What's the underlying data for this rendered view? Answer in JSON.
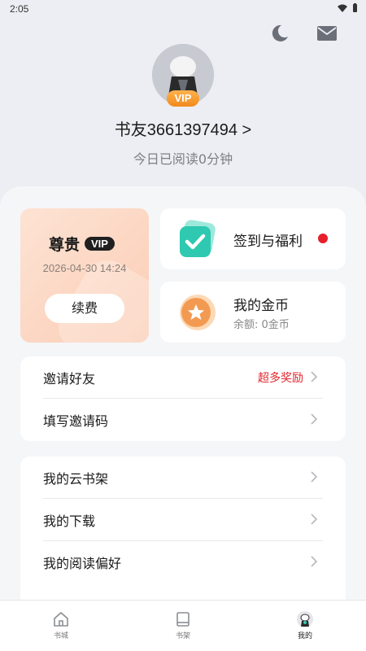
{
  "status_bar": {
    "time": "2:05",
    "icons": [
      "wifi-icon",
      "battery-icon"
    ]
  },
  "header": {
    "icons": [
      "moon-icon",
      "mail-icon"
    ],
    "avatar_badge": "VIP",
    "username": "书友3661397494 >",
    "read_time": "今日已阅读0分钟"
  },
  "vip_card": {
    "title": "尊贵",
    "badge": "VIP",
    "expire_date": "2026-04-30 14:24",
    "renew_label": "续费"
  },
  "checkin_card": {
    "label": "签到与福利",
    "has_notification": true
  },
  "coins_card": {
    "label": "我的金币",
    "balance": "余额: 0金币"
  },
  "invite_list": [
    {
      "label": "邀请好友",
      "extra": "超多奖励"
    },
    {
      "label": "填写邀请码",
      "extra": ""
    }
  ],
  "menu_list": [
    {
      "label": "我的云书架"
    },
    {
      "label": "我的下载"
    },
    {
      "label": "我的阅读偏好"
    }
  ],
  "bottom_nav": [
    {
      "label": "书城",
      "icon": "home-icon",
      "active": false
    },
    {
      "label": "书架",
      "icon": "book-icon",
      "active": false
    },
    {
      "label": "我的",
      "icon": "profile-icon",
      "active": true
    }
  ],
  "colors": {
    "accent_red": "#e5202c",
    "vip_orange": "#f08a1c",
    "teal": "#2ec9b0"
  }
}
